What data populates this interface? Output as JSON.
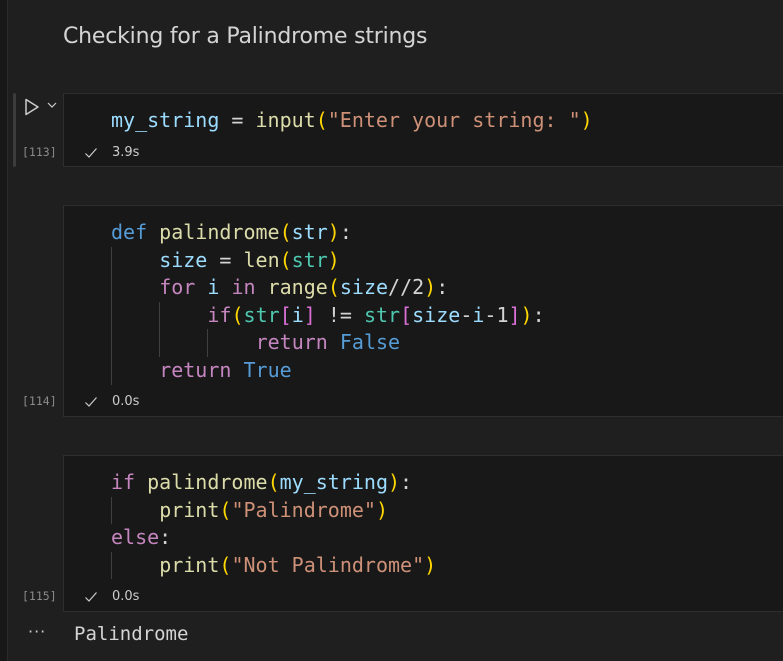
{
  "markdown_heading": "Checking for a Palindrome strings",
  "colors": {
    "keyword": "#569cd6",
    "control": "#c586c0",
    "function": "#dcdcaa",
    "variable": "#9cdcfe",
    "builtin": "#4ec9b0",
    "string": "#ce9178",
    "bracket1": "#ffd700",
    "bracket2": "#da70d6",
    "bracket3": "#179fff",
    "plain": "#d4d4d4"
  },
  "cells": [
    {
      "execution_count": "[113]",
      "status": "✓",
      "duration": "3.9s",
      "lines": [
        {
          "indent": 0,
          "tokens": [
            [
              "my_string",
              "variable"
            ],
            [
              " = ",
              "plain"
            ],
            [
              "input",
              "function"
            ],
            [
              "(",
              "bracket1"
            ],
            [
              "\"Enter your string: \"",
              "string"
            ],
            [
              ")",
              "bracket1"
            ]
          ]
        }
      ]
    },
    {
      "execution_count": "[114]",
      "status": "✓",
      "duration": "0.0s",
      "lines": [
        {
          "indent": 0,
          "tokens": [
            [
              "def",
              "keyword"
            ],
            [
              " ",
              "plain"
            ],
            [
              "palindrome",
              "function"
            ],
            [
              "(",
              "bracket1"
            ],
            [
              "str",
              "variable"
            ],
            [
              ")",
              "bracket1"
            ],
            [
              ":",
              "plain"
            ]
          ]
        },
        {
          "indent": 1,
          "tokens": [
            [
              "size",
              "variable"
            ],
            [
              " = ",
              "plain"
            ],
            [
              "len",
              "function"
            ],
            [
              "(",
              "bracket1"
            ],
            [
              "str",
              "builtin"
            ],
            [
              ")",
              "bracket1"
            ]
          ]
        },
        {
          "indent": 1,
          "tokens": [
            [
              "for",
              "control"
            ],
            [
              " ",
              "plain"
            ],
            [
              "i",
              "variable"
            ],
            [
              " ",
              "plain"
            ],
            [
              "in",
              "control"
            ],
            [
              " ",
              "plain"
            ],
            [
              "range",
              "function"
            ],
            [
              "(",
              "bracket1"
            ],
            [
              "size",
              "variable"
            ],
            [
              "//",
              "plain"
            ],
            [
              "2",
              "plain"
            ],
            [
              ")",
              "bracket1"
            ],
            [
              ":",
              "plain"
            ]
          ]
        },
        {
          "indent": 2,
          "tokens": [
            [
              "if",
              "control"
            ],
            [
              "(",
              "bracket1"
            ],
            [
              "str",
              "builtin"
            ],
            [
              "[",
              "bracket2"
            ],
            [
              "i",
              "variable"
            ],
            [
              "]",
              "bracket2"
            ],
            [
              " != ",
              "plain"
            ],
            [
              "str",
              "builtin"
            ],
            [
              "[",
              "bracket2"
            ],
            [
              "size",
              "variable"
            ],
            [
              "-",
              "plain"
            ],
            [
              "i",
              "variable"
            ],
            [
              "-",
              "plain"
            ],
            [
              "1",
              "plain"
            ],
            [
              "]",
              "bracket2"
            ],
            [
              ")",
              "bracket1"
            ],
            [
              ":",
              "plain"
            ]
          ]
        },
        {
          "indent": 3,
          "tokens": [
            [
              "return",
              "control"
            ],
            [
              " ",
              "plain"
            ],
            [
              "False",
              "keyword"
            ]
          ]
        },
        {
          "indent": 1,
          "tokens": [
            [
              "return",
              "control"
            ],
            [
              " ",
              "plain"
            ],
            [
              "True",
              "keyword"
            ]
          ]
        }
      ]
    },
    {
      "execution_count": "[115]",
      "status": "✓",
      "duration": "0.0s",
      "lines": [
        {
          "indent": 0,
          "tokens": [
            [
              "if",
              "control"
            ],
            [
              " ",
              "plain"
            ],
            [
              "palindrome",
              "function"
            ],
            [
              "(",
              "bracket1"
            ],
            [
              "my_string",
              "variable"
            ],
            [
              ")",
              "bracket1"
            ],
            [
              ":",
              "plain"
            ]
          ]
        },
        {
          "indent": 1,
          "tokens": [
            [
              "print",
              "function"
            ],
            [
              "(",
              "bracket1"
            ],
            [
              "\"Palindrome\"",
              "string"
            ],
            [
              ")",
              "bracket1"
            ]
          ]
        },
        {
          "indent": 0,
          "tokens": [
            [
              "else",
              "control"
            ],
            [
              ":",
              "plain"
            ]
          ]
        },
        {
          "indent": 1,
          "tokens": [
            [
              "print",
              "function"
            ],
            [
              "(",
              "bracket1"
            ],
            [
              "\"Not Palindrome\"",
              "string"
            ],
            [
              ")",
              "bracket1"
            ]
          ]
        }
      ]
    }
  ],
  "output": {
    "more_label": "···",
    "text": "Palindrome"
  }
}
